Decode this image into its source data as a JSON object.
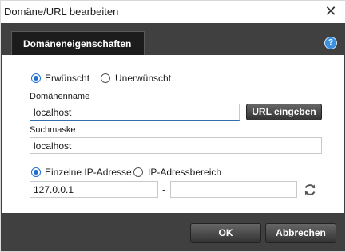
{
  "window": {
    "title": "Domäne/URL bearbeiten"
  },
  "tab": {
    "label": "Domäneneigenschaften"
  },
  "help": {
    "glyph": "?"
  },
  "mode": {
    "option_wanted": "Erwünscht",
    "option_unwanted": "Unerwünscht",
    "selected": "Erwünscht"
  },
  "domain": {
    "label": "Domänenname",
    "value": "localhost",
    "url_button": "URL eingeben"
  },
  "searchmask": {
    "label": "Suchmaske",
    "value": "localhost"
  },
  "ip": {
    "option_single": "Einzelne IP-Adresse",
    "option_range": "IP-Adressbereich",
    "selected": "Einzelne IP-Adresse",
    "from_value": "127.0.0.1",
    "separator": "-",
    "to_value": ""
  },
  "footer": {
    "ok_label": "OK",
    "cancel_label": "Abbrechen"
  },
  "colors": {
    "header_bg": "#404040",
    "tab_bg": "#1c1c1c",
    "accent": "#1f6fd0"
  }
}
